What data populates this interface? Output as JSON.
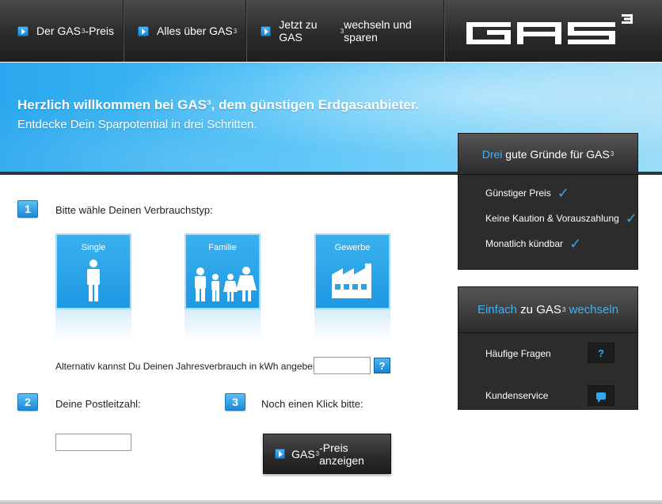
{
  "nav": {
    "items": [
      {
        "pre": "Der GAS",
        "sup": "3",
        "post": "-Preis"
      },
      {
        "pre": "Alles über GAS",
        "sup": "3",
        "post": ""
      },
      {
        "pre": "Jetzt zu GAS",
        "sup": "3",
        "post": " wechseln und sparen"
      }
    ],
    "logo_text": "GAS",
    "logo_sup": "3"
  },
  "banner": {
    "line1": "Herzlich willkommen bei GAS³, dem günstigen Erdgasanbieter.",
    "line2": "Entdecke Dein Sparpotential in drei Schritten."
  },
  "step1": {
    "number": "1",
    "label": "Bitte wähle Deinen Verbrauchstyp:",
    "types": [
      "Single",
      "Familie",
      "Gewerbe"
    ],
    "alt_text": "Alternativ kannst Du Deinen Jahresverbrauch in kWh angeben:",
    "kwh_value": "",
    "help_label": "?"
  },
  "step2": {
    "number": "2",
    "label": "Deine Postleitzahl:",
    "plz_value": ""
  },
  "step3": {
    "number": "3",
    "label": "Noch einen Klick bitte:",
    "button_pre": "GAS",
    "button_sup": "3",
    "button_post": "-Preis anzeigen"
  },
  "reasons": {
    "title_hl": "Drei",
    "title_rest": " gute Gründe für GAS",
    "title_sup": "3",
    "items": [
      "Günstiger Preis",
      "Keine Kaution & Vorauszahlung",
      "Monatlich kündbar"
    ],
    "check": "✓"
  },
  "switch": {
    "title_hl1": "Einfach",
    "title_mid": " zu GAS",
    "title_sup": "3",
    "title_hl2": " wechseln",
    "items": [
      "Häufige Fragen",
      "Kundenservice"
    ],
    "faq_icon": "?"
  },
  "colors": {
    "accent": "#30a8f0",
    "dark": "#2c2c2c"
  }
}
